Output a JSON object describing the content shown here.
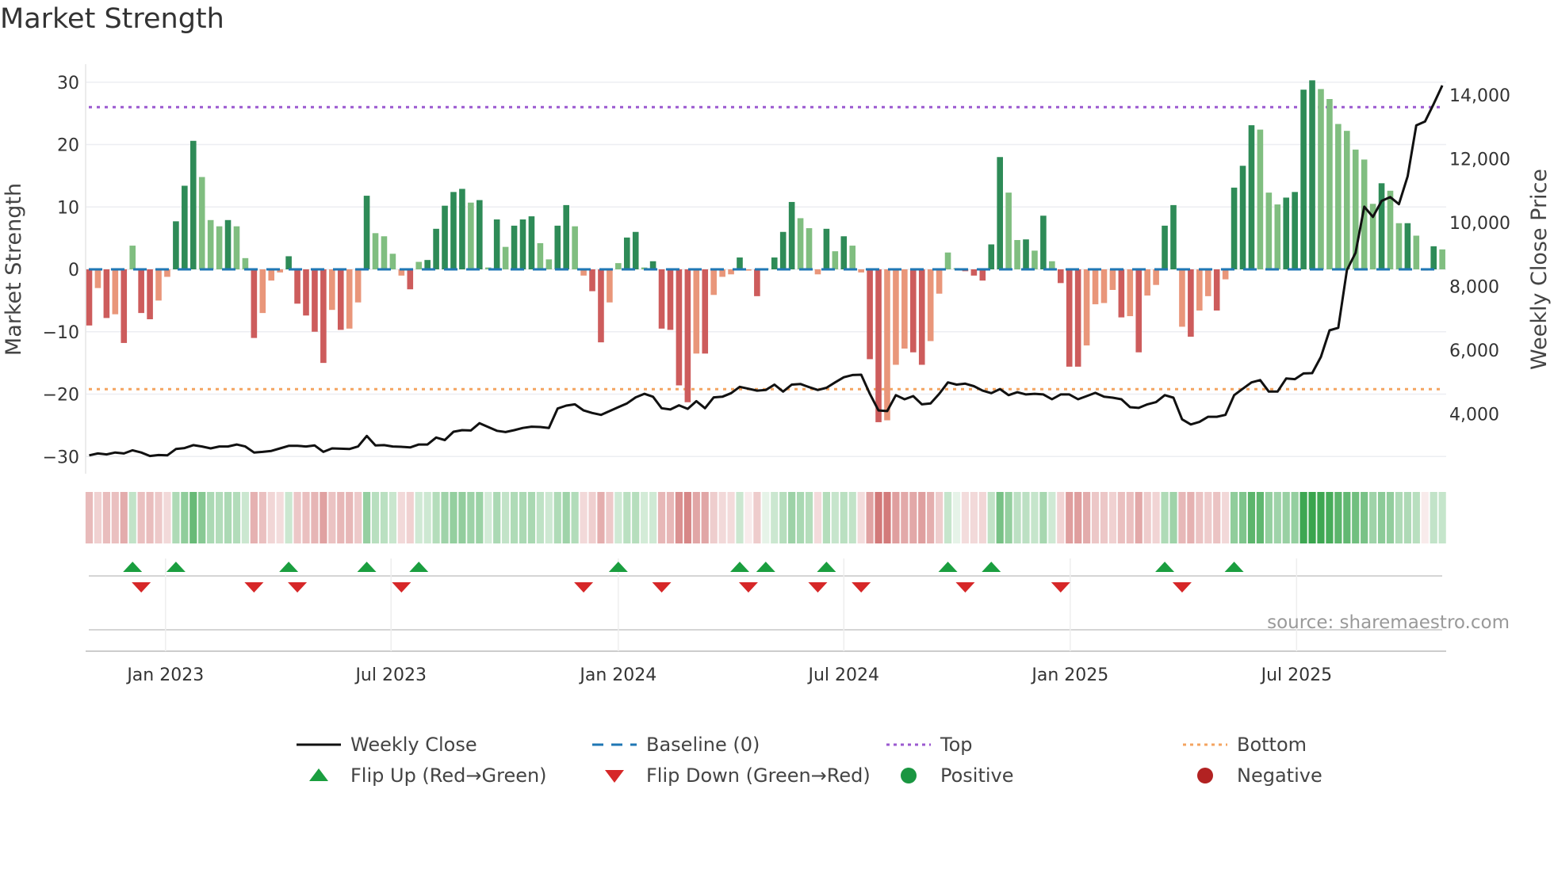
{
  "title": "Market Strength",
  "source": "source: sharemaestro.com",
  "colors": {
    "pos_strong": "#2e8b57",
    "pos_weak": "#80be80",
    "neg_strong": "#cd5c5c",
    "neg_weak": "#e9967a",
    "baseline": "#1f77b4",
    "top": "#9b59d0",
    "bottom": "#f4a460",
    "price": "#111111",
    "flip_up": "#1a9e3f",
    "flip_down": "#d62728",
    "positive": "#1a9641",
    "negative": "#b22222"
  },
  "chart_data": {
    "type": "bar+line",
    "title": "Market Strength",
    "ylabel": "Market Strength",
    "ylabel_right": "Weekly Close Price",
    "ylim": [
      -32.7,
      32.9
    ],
    "ylim_right": [
      2140,
      14960
    ],
    "y_ticks_left": [
      "−30",
      "−20",
      "−10",
      "0",
      "10",
      "20",
      "30"
    ],
    "y_tick_values_left": [
      -30,
      -20,
      -10,
      0,
      10,
      20,
      30
    ],
    "y_ticks_right": [
      "4,000",
      "6,000",
      "8,000",
      "10,000",
      "12,000",
      "14,000"
    ],
    "y_tick_values_right": [
      4000,
      6000,
      8000,
      10000,
      12000,
      14000
    ],
    "x_ticks": [
      {
        "label": "Jan 2023",
        "week_index": 8.8
      },
      {
        "label": "Jul 2023",
        "week_index": 34.8
      },
      {
        "label": "Jan 2024",
        "week_index": 61.0
      },
      {
        "label": "Jul 2024",
        "week_index": 87.0
      },
      {
        "label": "Jan 2025",
        "week_index": 113.1
      },
      {
        "label": "Jul 2025",
        "week_index": 139.2
      }
    ],
    "top_level": 26.0,
    "bottom_level": -19.2,
    "baseline": 0,
    "strength": [
      -9,
      -3,
      -7.8,
      -7.2,
      -11.8,
      3.8,
      -7,
      -8,
      -5,
      -1.2,
      7.7,
      13.4,
      20.6,
      14.8,
      7.9,
      6.9,
      7.9,
      6.9,
      1.8,
      -11,
      -7,
      -1.8,
      -0.5,
      2.1,
      -5.5,
      -7.4,
      -10,
      -15,
      -6.5,
      -9.7,
      -9.5,
      -5.3,
      11.8,
      5.8,
      5.3,
      2.5,
      -1,
      -3.2,
      1.2,
      1.5,
      6.5,
      10.2,
      12.4,
      12.9,
      10.7,
      11.1,
      0.3,
      8,
      3.6,
      7,
      8,
      8.5,
      4.2,
      1.6,
      7,
      10.3,
      6.9,
      -1,
      -3.5,
      -11.7,
      -5.3,
      1,
      5.1,
      6.0,
      0.3,
      1.3,
      -9.5,
      -9.7,
      -18.6,
      -21.3,
      -13.5,
      -13.5,
      -4.1,
      -1.2,
      -0.8,
      1.9,
      -0.2,
      -4.3,
      0.1,
      1.9,
      6,
      10.8,
      8.2,
      6.6,
      -0.8,
      6.5,
      2.9,
      5.3,
      3.8,
      -0.5,
      -14.4,
      -24.5,
      -24.2,
      -15.3,
      -12.7,
      -13.3,
      -15.3,
      -11.5,
      -3.9,
      2.7,
      0.2,
      -0.3,
      -1,
      -1.8,
      4,
      18,
      12.3,
      4.7,
      4.8,
      3,
      8.6,
      1.3,
      -2.2,
      -15.6,
      -15.6,
      -12.2,
      -5.6,
      -5.4,
      -3.3,
      -7.7,
      -7.5,
      -13.3,
      -4.2,
      -2.5,
      7,
      10.3,
      -9.2,
      -10.8,
      -6.6,
      -4.3,
      -6.6,
      -1.6,
      13.1,
      16.6,
      23.1,
      22.4,
      12.3,
      10.4,
      11.5,
      12.4,
      28.8,
      30.3,
      28.9,
      27.3,
      23.3,
      22.2,
      19.2,
      17.6,
      10.5,
      13.8,
      12.6,
      7.4,
      7.4,
      5.4,
      -0.2,
      3.7,
      3.2
    ],
    "weekly_close": [
      2700,
      2760,
      2730,
      2790,
      2760,
      2860,
      2790,
      2680,
      2710,
      2700,
      2900,
      2930,
      3020,
      2980,
      2920,
      2980,
      2980,
      3040,
      2980,
      2790,
      2810,
      2840,
      2920,
      3000,
      3000,
      2980,
      3010,
      2810,
      2920,
      2910,
      2900,
      2980,
      3310,
      3010,
      3020,
      2980,
      2970,
      2950,
      3040,
      3040,
      3260,
      3180,
      3440,
      3490,
      3480,
      3710,
      3590,
      3470,
      3430,
      3490,
      3560,
      3600,
      3590,
      3560,
      4170,
      4260,
      4300,
      4110,
      4030,
      3970,
      4090,
      4210,
      4330,
      4520,
      4630,
      4540,
      4180,
      4140,
      4270,
      4160,
      4400,
      4180,
      4520,
      4540,
      4650,
      4850,
      4790,
      4730,
      4750,
      4920,
      4700,
      4920,
      4940,
      4840,
      4750,
      4820,
      4990,
      5150,
      5220,
      5230,
      4630,
      4110,
      4090,
      4590,
      4460,
      4560,
      4300,
      4330,
      4630,
      4990,
      4920,
      4950,
      4870,
      4730,
      4650,
      4780,
      4590,
      4680,
      4610,
      4630,
      4610,
      4460,
      4610,
      4610,
      4460,
      4560,
      4660,
      4540,
      4510,
      4460,
      4210,
      4190,
      4300,
      4370,
      4590,
      4510,
      3830,
      3670,
      3750,
      3910,
      3910,
      3970,
      4590,
      4790,
      4990,
      5060,
      4700,
      4700,
      5110,
      5090,
      5270,
      5280,
      5790,
      6620,
      6700,
      8510,
      9050,
      10500,
      10180,
      10680,
      10800,
      10580,
      11450,
      13050,
      13170,
      13720,
      14300
    ],
    "flip_up_weeks": [
      5,
      10,
      23,
      32,
      38,
      61,
      75,
      78,
      85,
      99,
      104,
      124,
      132
    ],
    "flip_down_weeks": [
      6,
      19,
      24,
      36,
      57,
      66,
      76,
      84,
      89,
      101,
      112,
      126
    ],
    "legend": {
      "placement": "bottom",
      "items": [
        {
          "label": "Weekly Close",
          "kind": "line"
        },
        {
          "label": "Baseline (0)",
          "kind": "baseline"
        },
        {
          "label": "Top",
          "kind": "top"
        },
        {
          "label": "Bottom",
          "kind": "bottom"
        },
        {
          "label": "Flip Up (Red→Green)",
          "kind": "up"
        },
        {
          "label": "Flip Down (Green→Red)",
          "kind": "down"
        },
        {
          "label": "Positive",
          "kind": "positive"
        },
        {
          "label": "Negative",
          "kind": "negative"
        }
      ]
    }
  }
}
